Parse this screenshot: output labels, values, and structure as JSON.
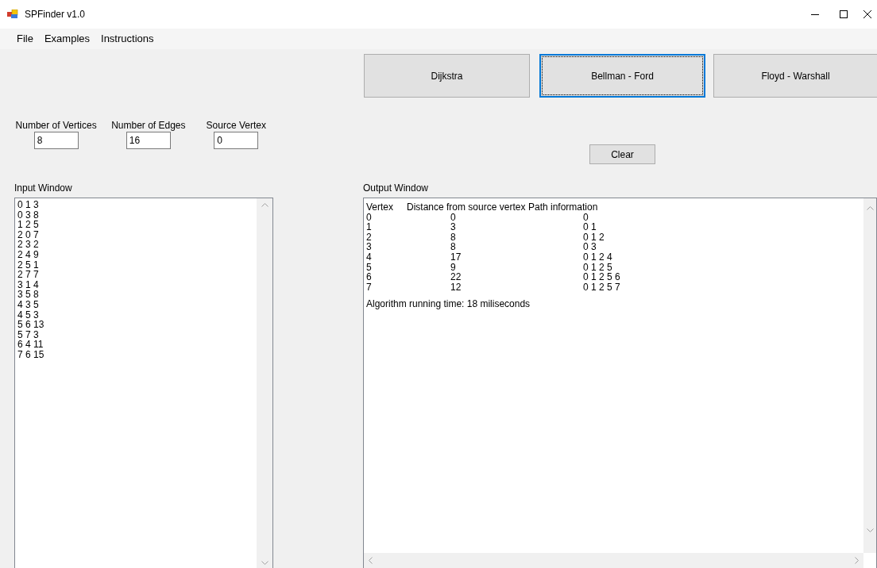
{
  "window": {
    "title": "SPFinder v1.0"
  },
  "menu": [
    {
      "label": "File"
    },
    {
      "label": "Examples"
    },
    {
      "label": "Instructions"
    }
  ],
  "algorithms": [
    {
      "label": "Dijkstra",
      "selected": false
    },
    {
      "label": "Bellman - Ford",
      "selected": true
    },
    {
      "label": "Floyd - Warshall",
      "selected": false
    }
  ],
  "fields": [
    {
      "label": "Number of Vertices",
      "value": "8"
    },
    {
      "label": "Number of Edges",
      "value": "16"
    },
    {
      "label": "Source Vertex",
      "value": "0"
    }
  ],
  "clear_button": "Clear",
  "input_window": {
    "label": "Input Window",
    "lines": [
      "0 1 3",
      "0 3 8",
      "1 2 5",
      "2 0 7",
      "2 3 2",
      "2 4 9",
      "2 5 1",
      "2 7 7",
      "3 1 4",
      "3 5 8",
      "4 3 5",
      "4 5 3",
      "5 6 13",
      "5 7 3",
      "6 4 11",
      "7 6 15"
    ]
  },
  "output_window": {
    "label": "Output Window",
    "columns": [
      "Vertex",
      "Distance from source vertex",
      "Path information"
    ],
    "rows": [
      [
        "0",
        "0",
        "0"
      ],
      [
        "1",
        "3",
        "0 1"
      ],
      [
        "2",
        "8",
        "0 1 2"
      ],
      [
        "3",
        "8",
        "0 3"
      ],
      [
        "4",
        "17",
        "0 1 2 4"
      ],
      [
        "5",
        "9",
        "0 1 2 5"
      ],
      [
        "6",
        "22",
        "0 1 2 5 6"
      ],
      [
        "7",
        "12",
        "0 1 2 5 7"
      ]
    ],
    "footer": "Algorithm running time: 18 miliseconds"
  }
}
